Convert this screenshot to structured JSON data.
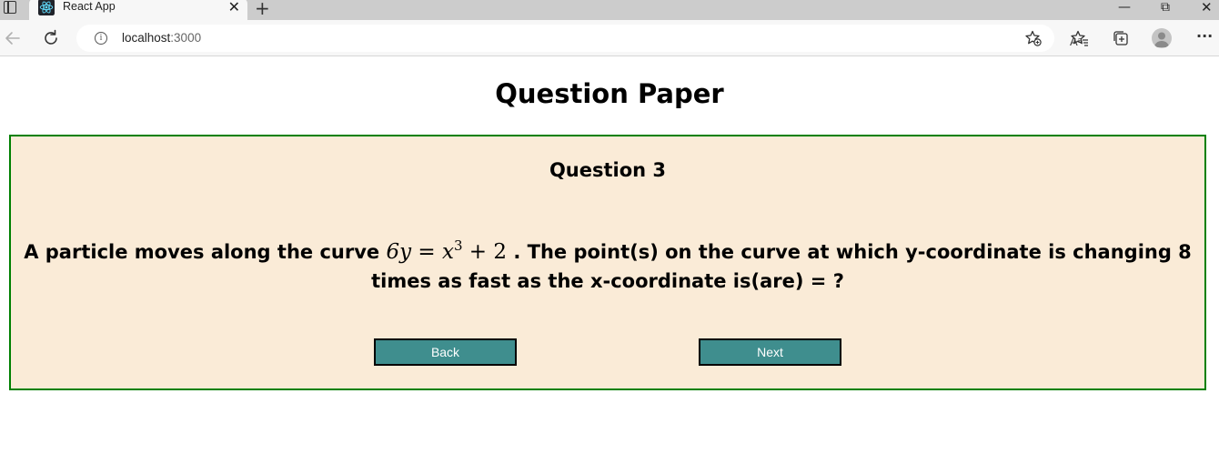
{
  "browser": {
    "tab_title": "React App",
    "tab_close": "✕",
    "new_tab": "+",
    "url_host": "localhost",
    "url_port": ":3000",
    "read_aloud": "Aᵃ",
    "window_minimize": "—",
    "window_restore": "⧉",
    "window_close": "✕",
    "more": "···"
  },
  "page": {
    "title": "Question Paper"
  },
  "question": {
    "number_label": "Question 3",
    "text_before": "A particle moves along the curve ",
    "math_lhs": "6y = x",
    "math_exp": "3",
    "math_rhs": " + 2",
    "text_after": " . The point(s) on the curve at which y-coordinate is changing 8 times as fast as the x-coordinate is(are) = ?"
  },
  "buttons": {
    "back_label": "Back",
    "next_label": "Next"
  },
  "colors": {
    "card_background": "#faebd7",
    "card_border": "#008000",
    "button_background": "#3f8e8e"
  }
}
